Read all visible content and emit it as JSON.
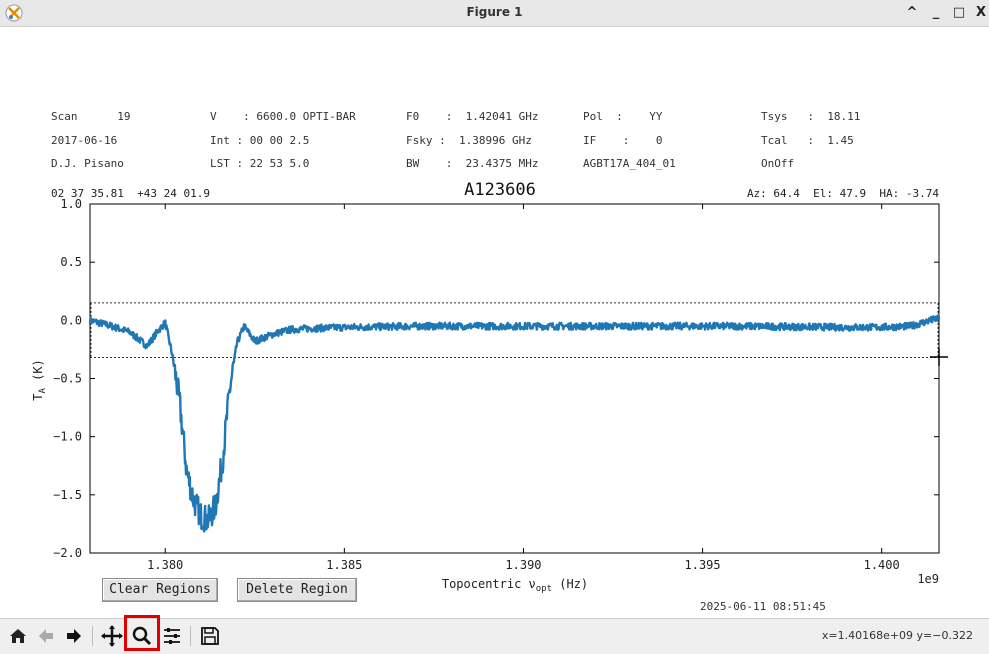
{
  "window": {
    "title": "Figure 1",
    "controls": [
      "^",
      "_",
      "□",
      "X"
    ]
  },
  "header": {
    "col1": [
      "Scan      19",
      "2017-06-16",
      "D.J. Pisano"
    ],
    "col2": [
      "V    : 6600.0 OPTI-BAR",
      "Int : 00 00 2.5",
      "LST : 22 53 5.0"
    ],
    "col3": [
      "F0    :  1.42041 GHz",
      "Fsky :  1.38996 GHz",
      "BW    :  23.4375 MHz"
    ],
    "col4": [
      "Pol  :    YY",
      "IF    :    0",
      "AGBT17A_404_01"
    ],
    "col5": [
      "Tsys   :  18.11",
      "Tcal   :  1.45",
      "OnOff"
    ],
    "coords_left": "02 37 35.81  +43 24 01.9",
    "coords_right": "Az: 64.4  El: 47.9  HA: -3.74"
  },
  "chart_data": {
    "type": "line",
    "title": "A123606",
    "xlabel": "Topocentric ν_opt (Hz)",
    "ylabel": "T_A (K)",
    "x_offset_label": "1e9",
    "xlim": [
      1.3779,
      1.4016
    ],
    "ylim": [
      -2.0,
      1.0
    ],
    "x_ticks": [
      1.38,
      1.385,
      1.39,
      1.395,
      1.4
    ],
    "x_tick_labels": [
      "1.380",
      "1.385",
      "1.390",
      "1.395",
      "1.400"
    ],
    "y_ticks": [
      1.0,
      0.5,
      0.0,
      -0.5,
      -1.0,
      -1.5,
      -2.0
    ],
    "y_tick_labels": [
      "1.0",
      "0.5",
      "0.0",
      "−0.5",
      "−1.0",
      "−1.5",
      "−2.0"
    ],
    "region_lines_y": [
      0.15,
      -0.32
    ],
    "grid": false,
    "series": [
      {
        "color": "#1f77b4",
        "x": [
          1.3779,
          1.3785,
          1.379,
          1.3795,
          1.3798,
          1.38,
          1.3802,
          1.3804,
          1.3806,
          1.3808,
          1.381,
          1.3812,
          1.3814,
          1.3816,
          1.3818,
          1.382,
          1.3822,
          1.3825,
          1.383,
          1.3835,
          1.384,
          1.385,
          1.387,
          1.39,
          1.393,
          1.396,
          1.399,
          1.4,
          1.4008,
          1.4016
        ],
        "y": [
          0.0,
          -0.05,
          -0.1,
          -0.22,
          -0.09,
          -0.02,
          -0.3,
          -0.7,
          -1.3,
          -1.55,
          -1.68,
          -1.72,
          -1.6,
          -1.2,
          -0.6,
          -0.2,
          -0.05,
          -0.18,
          -0.12,
          -0.08,
          -0.07,
          -0.06,
          -0.05,
          -0.05,
          -0.05,
          -0.05,
          -0.06,
          -0.06,
          -0.05,
          0.02
        ],
        "noise": 0.03
      }
    ]
  },
  "buttons": {
    "clear_regions": "Clear Regions",
    "delete_region": "Delete Region"
  },
  "timestamp": "2025-06-11 08:51:45",
  "toolbar": {
    "items": [
      "home-icon",
      "back-icon",
      "forward-icon",
      "pan-icon",
      "zoom-icon",
      "configure-icon",
      "save-icon"
    ],
    "readout": "x=1.40168e+09  y=−0.322"
  }
}
